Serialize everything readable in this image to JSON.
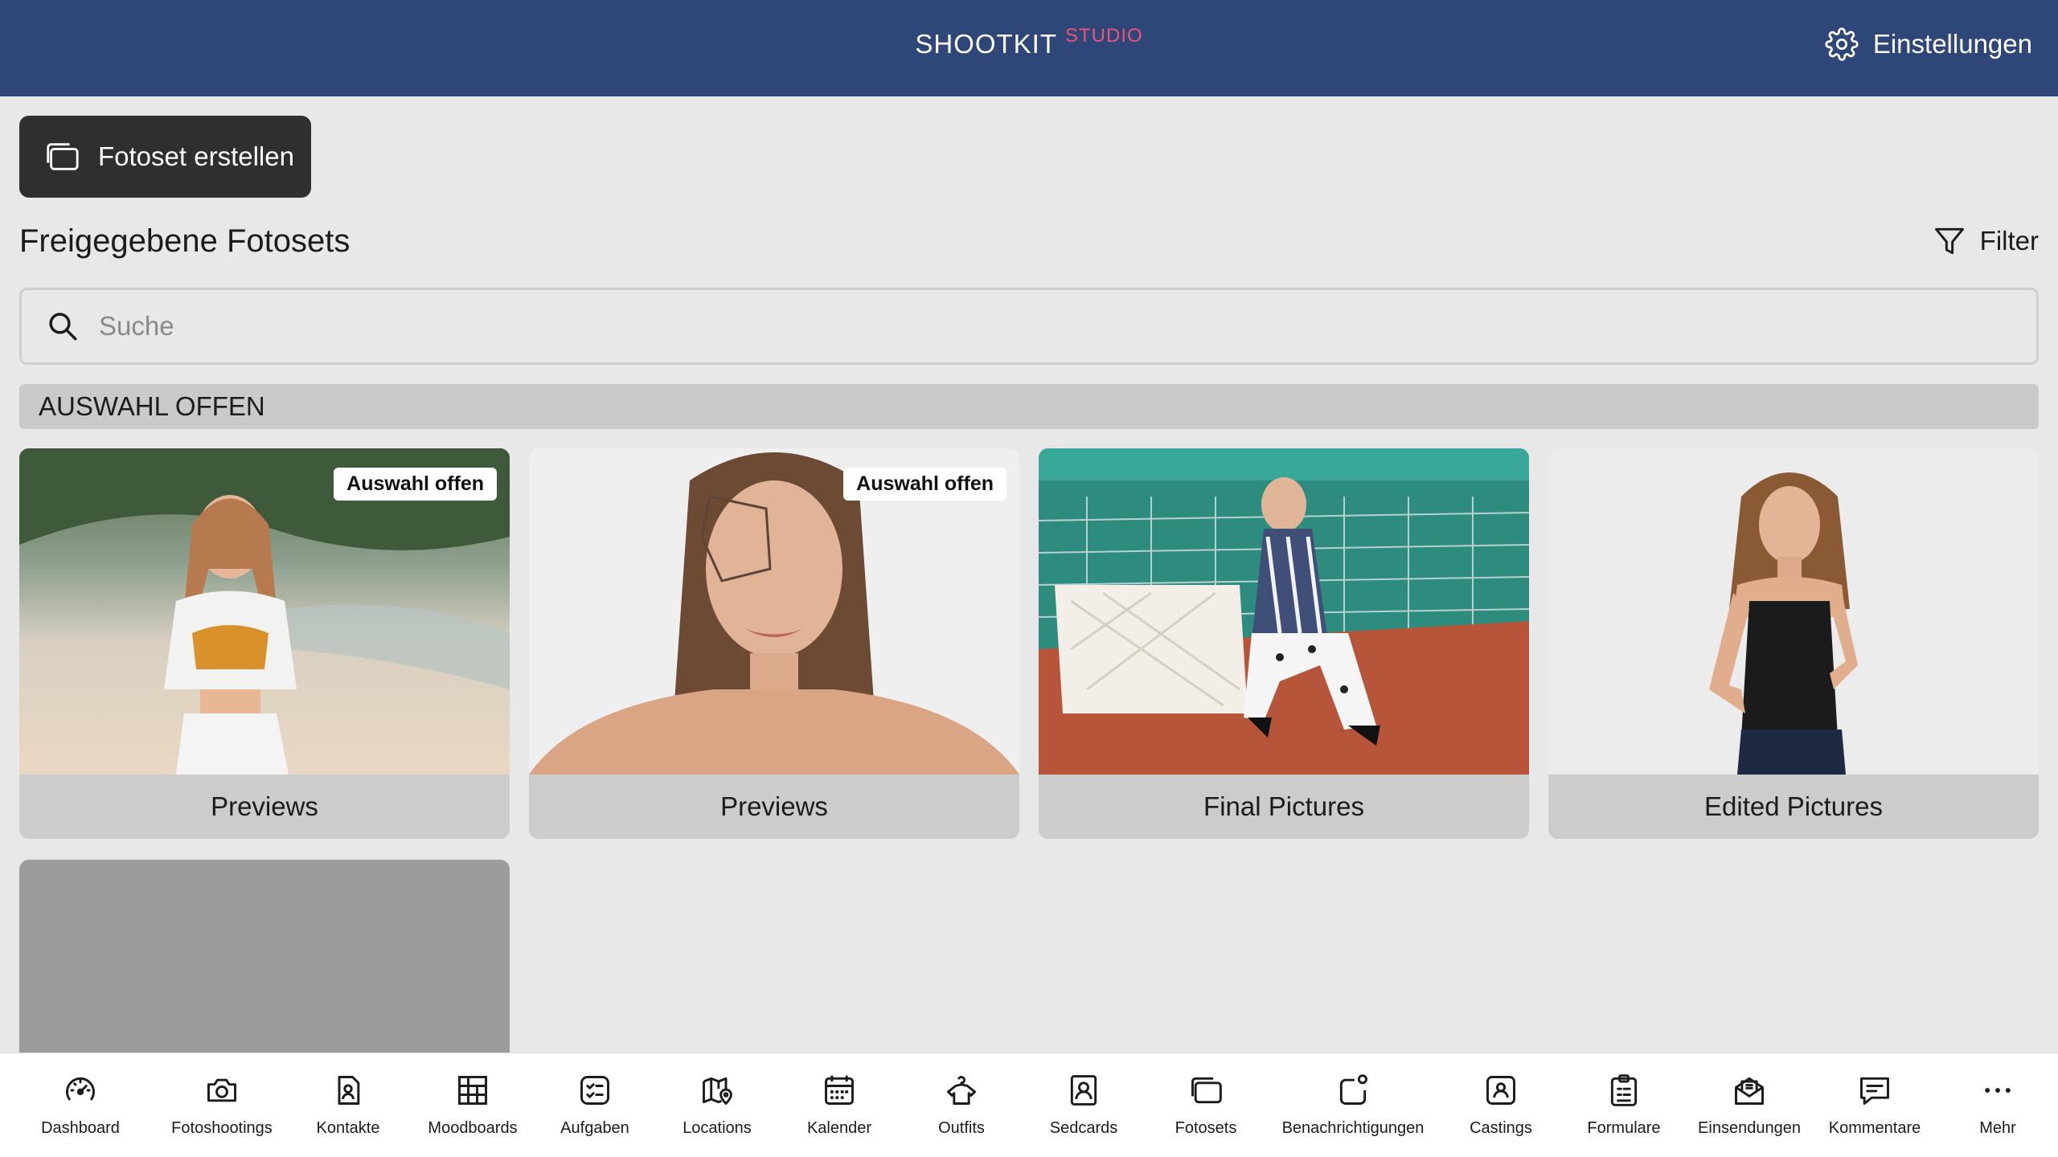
{
  "header": {
    "brand_main": "SHOOTKIT",
    "brand_sub": "STUDIO",
    "settings_label": "Einstellungen"
  },
  "toolbar": {
    "create_label": "Fotoset erstellen"
  },
  "section": {
    "title": "Freigegebene Fotosets",
    "filter_label": "Filter"
  },
  "search": {
    "placeholder": "Suche",
    "value": ""
  },
  "group": {
    "title": "AUSWAHL OFFEN"
  },
  "cards": [
    {
      "label": "Previews",
      "badge": "Auswahl offen"
    },
    {
      "label": "Previews",
      "badge": "Auswahl offen"
    },
    {
      "label": "Final Pictures",
      "badge": ""
    },
    {
      "label": "Edited Pictures",
      "badge": ""
    }
  ],
  "tabs": [
    {
      "label": "Dashboard",
      "icon": "gauge-icon"
    },
    {
      "label": "Fotoshootings",
      "icon": "camera-icon"
    },
    {
      "label": "Kontakte",
      "icon": "contact-card-icon"
    },
    {
      "label": "Moodboards",
      "icon": "grid-board-icon"
    },
    {
      "label": "Aufgaben",
      "icon": "checklist-icon"
    },
    {
      "label": "Locations",
      "icon": "map-pin-icon"
    },
    {
      "label": "Kalender",
      "icon": "calendar-icon"
    },
    {
      "label": "Outfits",
      "icon": "hanger-icon"
    },
    {
      "label": "Sedcards",
      "icon": "portrait-card-icon"
    },
    {
      "label": "Fotosets",
      "icon": "photo-stack-icon"
    },
    {
      "label": "Benachrichtigungen",
      "icon": "notification-icon"
    },
    {
      "label": "Castings",
      "icon": "casting-icon"
    },
    {
      "label": "Formulare",
      "icon": "clipboard-icon"
    },
    {
      "label": "Einsendungen",
      "icon": "envelope-icon"
    },
    {
      "label": "Kommentare",
      "icon": "comment-icon"
    },
    {
      "label": "Mehr",
      "icon": "more-dots-icon"
    }
  ]
}
